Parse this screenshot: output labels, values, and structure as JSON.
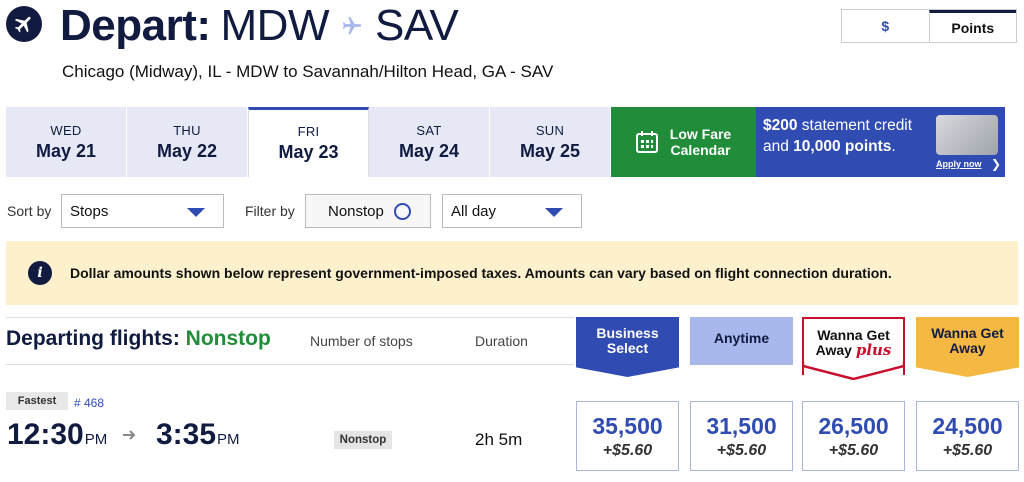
{
  "header": {
    "title_strong": "Depart:",
    "origin": "MDW",
    "destination": "SAV",
    "subtitle": "Chicago (Midway), IL - MDW to Savannah/Hilton Head, GA - SAV",
    "plane_icon": "airplane-icon",
    "currency_toggle": {
      "dollar": "$",
      "points": "Points",
      "selected": "Points"
    }
  },
  "date_tabs": [
    {
      "dow": "WED",
      "day": "May 21",
      "selected": false
    },
    {
      "dow": "THU",
      "day": "May 22",
      "selected": false
    },
    {
      "dow": "FRI",
      "day": "May 23",
      "selected": true
    },
    {
      "dow": "SAT",
      "day": "May 24",
      "selected": false
    },
    {
      "dow": "SUN",
      "day": "May 25",
      "selected": false
    }
  ],
  "low_fare": {
    "line1": "Low Fare",
    "line2": "Calendar",
    "icon": "calendar-icon"
  },
  "promo": {
    "amount": "$200",
    "text1": " statement credit and ",
    "points": "10,000 points",
    "text2": ".",
    "apply": "Apply now"
  },
  "controls": {
    "sort_label": "Sort by",
    "sort_value": "Stops",
    "filter_label": "Filter by",
    "nonstop_label": "Nonstop",
    "time_value": "All day"
  },
  "notice": {
    "text": "Dollar amounts shown below represent government-imposed taxes. Amounts can vary based on flight connection duration."
  },
  "flights_header": {
    "title": "Departing flights:",
    "filter": "Nonstop",
    "col_stops": "Number of stops",
    "col_duration": "Duration",
    "fare_business": "Business Select",
    "fare_anytime": "Anytime",
    "fare_wgap": "Wanna Get Away",
    "fare_wgap_plus": "plus",
    "fare_wga": "Wanna Get Away"
  },
  "flight": {
    "badge": "Fastest",
    "number": "# 468",
    "depart_time": "12:30",
    "depart_ampm": "PM",
    "arrive_time": "3:35",
    "arrive_ampm": "PM",
    "stops": "Nonstop",
    "duration": "2h 5m",
    "fares": [
      {
        "points": "35,500",
        "tax": "+$5.60"
      },
      {
        "points": "31,500",
        "tax": "+$5.60"
      },
      {
        "points": "26,500",
        "tax": "+$5.60"
      },
      {
        "points": "24,500",
        "tax": "+$5.60"
      }
    ]
  },
  "colors": {
    "navy": "#111b40",
    "blue": "#304cb2",
    "green": "#218d3a",
    "red": "#c8102e",
    "gold": "#f5b943"
  }
}
